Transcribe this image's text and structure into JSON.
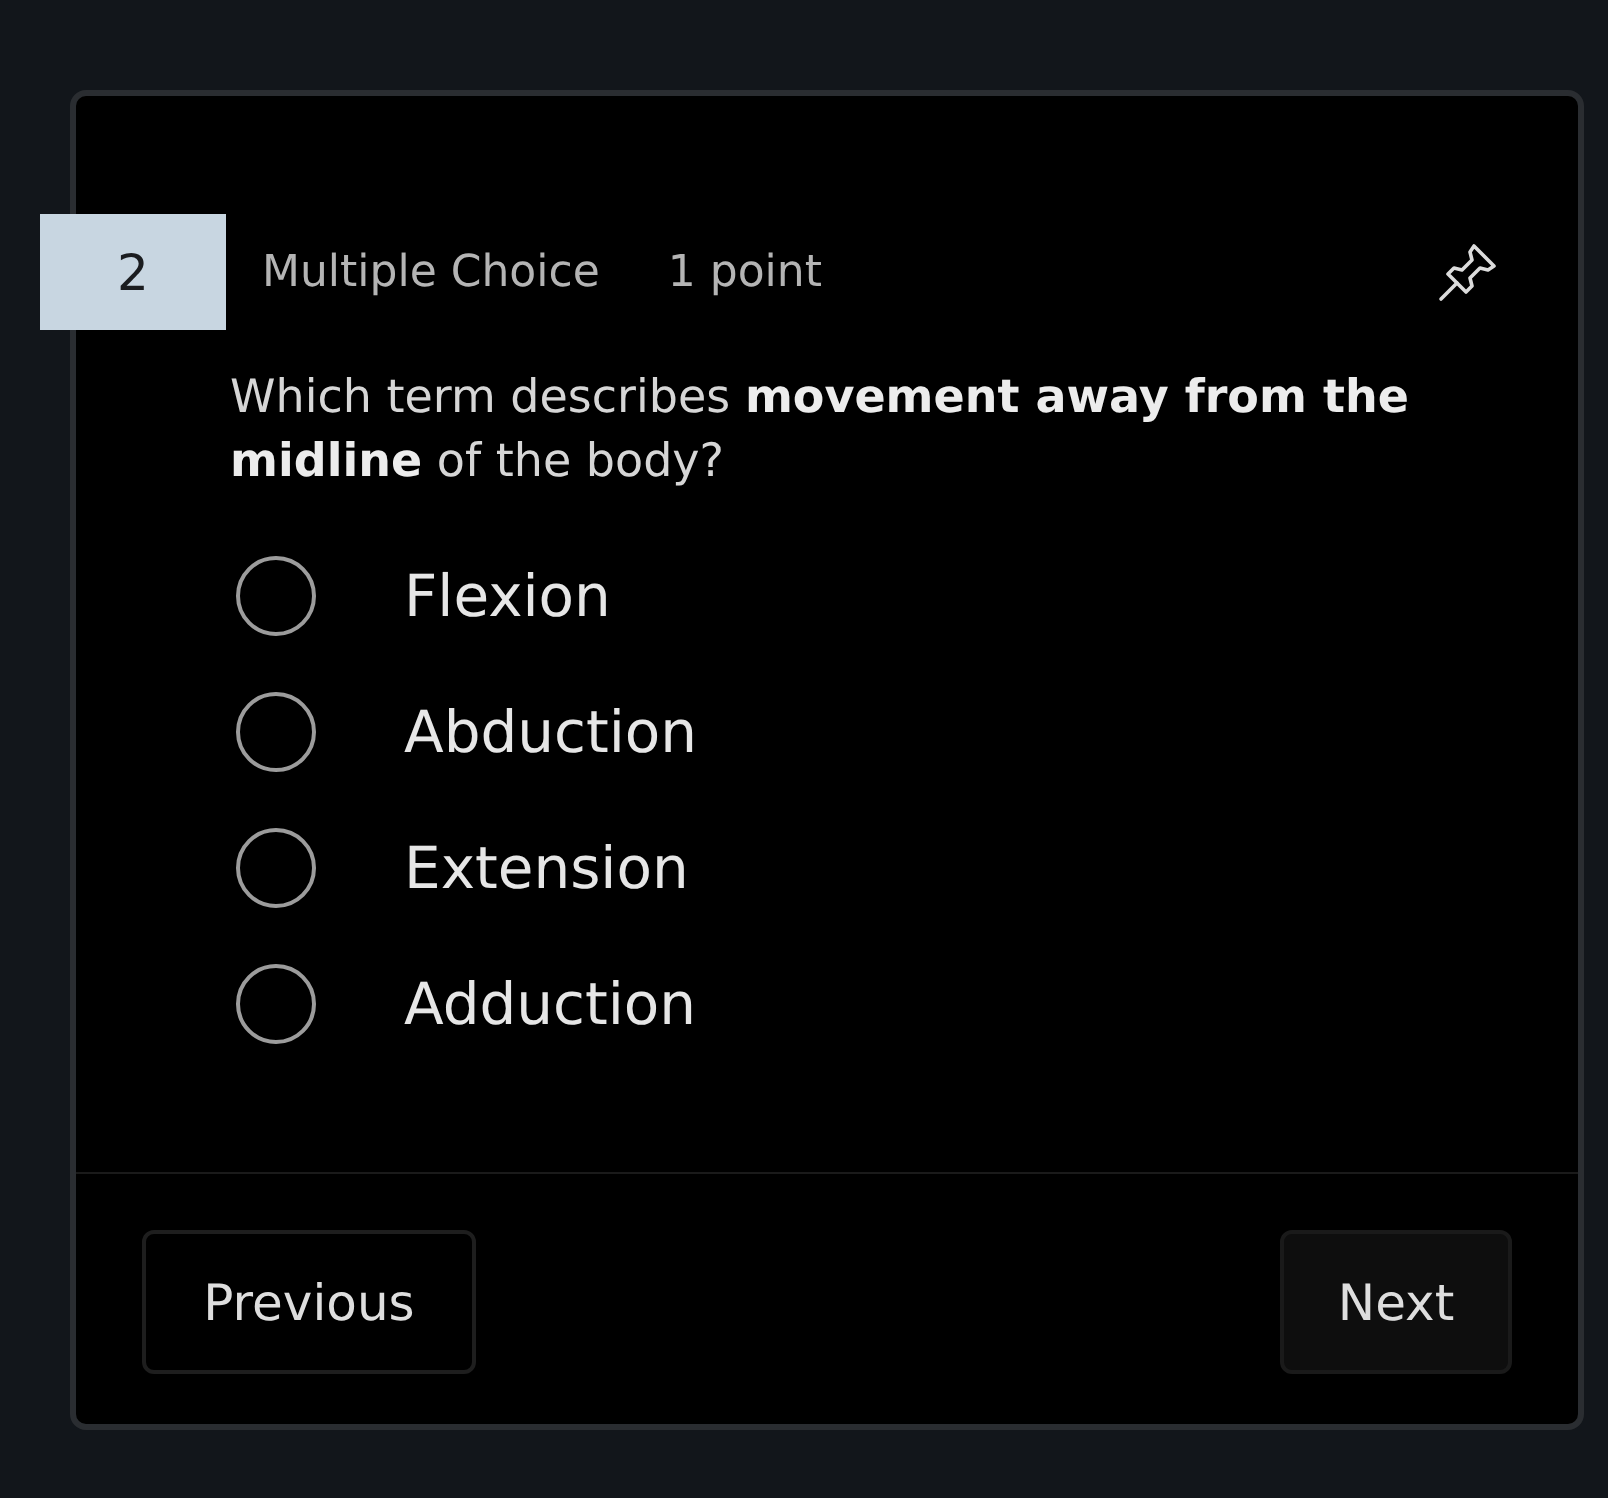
{
  "question": {
    "number": "2",
    "type": "Multiple Choice",
    "points": "1 point",
    "text": "Which term describes **movement away from the midline** of the body?"
  },
  "options": [
    {
      "label": "Flexion",
      "selected": false
    },
    {
      "label": "Abduction",
      "selected": false
    },
    {
      "label": "Extension",
      "selected": false
    },
    {
      "label": "Adduction",
      "selected": false
    }
  ],
  "navigation": {
    "previous": "Previous",
    "next": "Next"
  }
}
